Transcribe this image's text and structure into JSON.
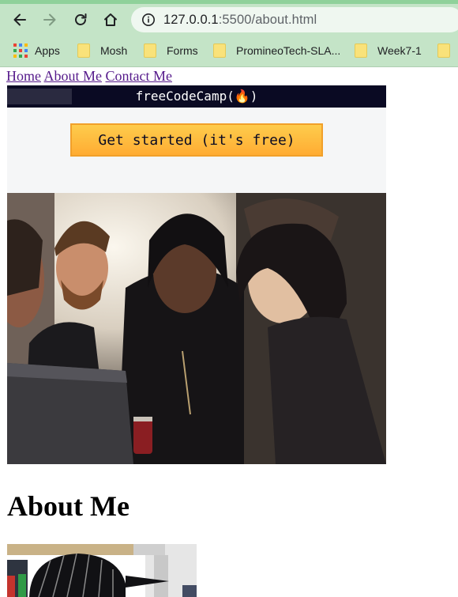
{
  "browser": {
    "url_host": "127.0.0.1",
    "url_path": ":5500/about.html",
    "bookmarks": [
      {
        "label": "Apps"
      },
      {
        "label": "Mosh"
      },
      {
        "label": "Forms"
      },
      {
        "label": "PromineoTech-SLA..."
      },
      {
        "label": "Week7-1"
      }
    ]
  },
  "page": {
    "nav": {
      "home": "Home",
      "about": "About Me",
      "contact": "Contact Me"
    },
    "banner": {
      "logo_text": "freeCodeCamp(🔥)",
      "cta_label": "Get started (it's free)"
    },
    "heading": "About Me"
  },
  "colors": {
    "chrome_green": "#c4e4c7",
    "fcc_dark": "#0a0a23",
    "cta_yellow": "#fecc4c",
    "link_visited": "#551a8b"
  }
}
